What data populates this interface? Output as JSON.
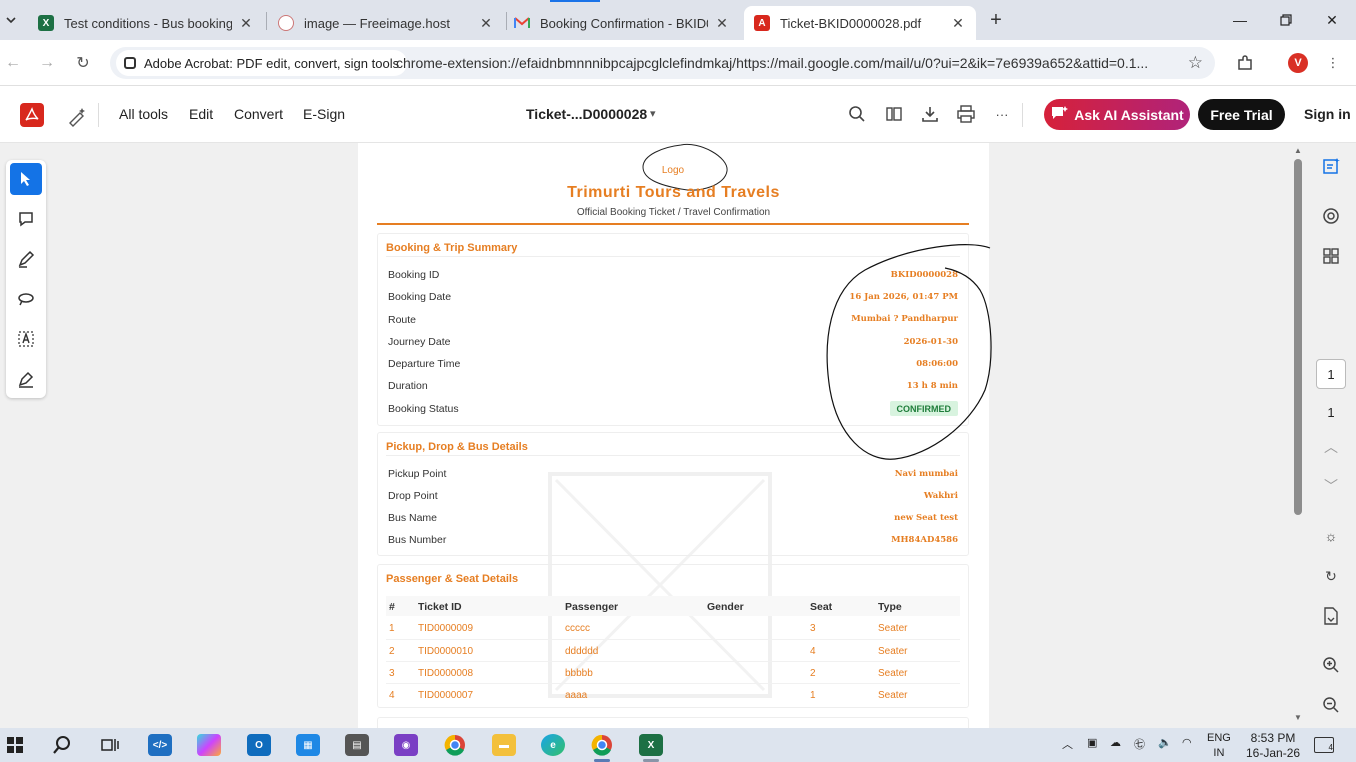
{
  "tabs": [
    {
      "title": "Test conditions - Bus booking.xl",
      "icon": "excel-icon",
      "color": "#1d7044"
    },
    {
      "title": "image — Freeimage.host",
      "icon": "freeimage-icon",
      "color": "#e8ecf2"
    },
    {
      "title": "Booking Confirmation - BKID00",
      "icon": "gmail-icon",
      "color": "#ea4335"
    },
    {
      "title": "Ticket-BKID0000028.pdf",
      "icon": "acrobat-icon",
      "color": "#d8281d"
    }
  ],
  "address_bar": {
    "extension_label": "Adobe Acrobat: PDF edit, convert, sign tools",
    "url": "chrome-extension://efaidnbmnnnibpcajpcglclefindmkaj/https://mail.google.com/mail/u/0?ui=2&ik=7e6939a652&attid=0.1...",
    "profile_initial": "V"
  },
  "acrobat": {
    "menu": [
      "All tools",
      "Edit",
      "Convert",
      "E-Sign"
    ],
    "doc_title": "Ticket-...D0000028",
    "ai_button": "Ask AI Assistant",
    "trial_button": "Free Trial",
    "signin": "Sign in",
    "page_current": "1",
    "page_total": "1"
  },
  "ticket": {
    "logo": "Logo",
    "company": "Trimurti Tours and Travels",
    "subtitle": "Official Booking Ticket / Travel Confirmation",
    "summary": {
      "title": "Booking & Trip Summary",
      "rows": [
        {
          "label": "Booking ID",
          "value": "BKID0000028"
        },
        {
          "label": "Booking Date",
          "value": "16 Jan 2026, 01:47 PM"
        },
        {
          "label": "Route",
          "value": "Mumbai ? Pandharpur"
        },
        {
          "label": "Journey Date",
          "value": "2026-01-30"
        },
        {
          "label": "Departure Time",
          "value": "08:06:00"
        },
        {
          "label": "Duration",
          "value": "13 h 8 min"
        },
        {
          "label": "Booking Status",
          "value": "CONFIRMED"
        }
      ]
    },
    "pickup": {
      "title": "Pickup, Drop & Bus Details",
      "rows": [
        {
          "label": "Pickup Point",
          "value": "Navi mumbai"
        },
        {
          "label": "Drop Point",
          "value": "Wakhri"
        },
        {
          "label": "Bus Name",
          "value": "new Seat test"
        },
        {
          "label": "Bus Number",
          "value": "MH84AD4586"
        }
      ]
    },
    "passengers": {
      "title": "Passenger & Seat Details",
      "headers": [
        "#",
        "Ticket ID",
        "Passenger",
        "Gender",
        "Seat",
        "Type"
      ],
      "rows": [
        [
          "1",
          "TID0000009",
          "ccccc",
          "",
          "3",
          "Seater"
        ],
        [
          "2",
          "TID0000010",
          "dddddd",
          "",
          "4",
          "Seater"
        ],
        [
          "3",
          "TID0000008",
          "bbbbb",
          "",
          "2",
          "Seater"
        ],
        [
          "4",
          "TID0000007",
          "aaaa",
          "",
          "1",
          "Seater"
        ]
      ]
    }
  },
  "taskbar": {
    "lang_top": "ENG",
    "lang_bottom": "IN",
    "time": "8:53 PM",
    "date": "16-Jan-26",
    "notifications": "4"
  },
  "colors": {
    "accent": "#e67e22",
    "acrobat_red": "#d8281d",
    "confirmed_bg": "#d8f3df",
    "confirmed_text": "#1e7d3a"
  }
}
